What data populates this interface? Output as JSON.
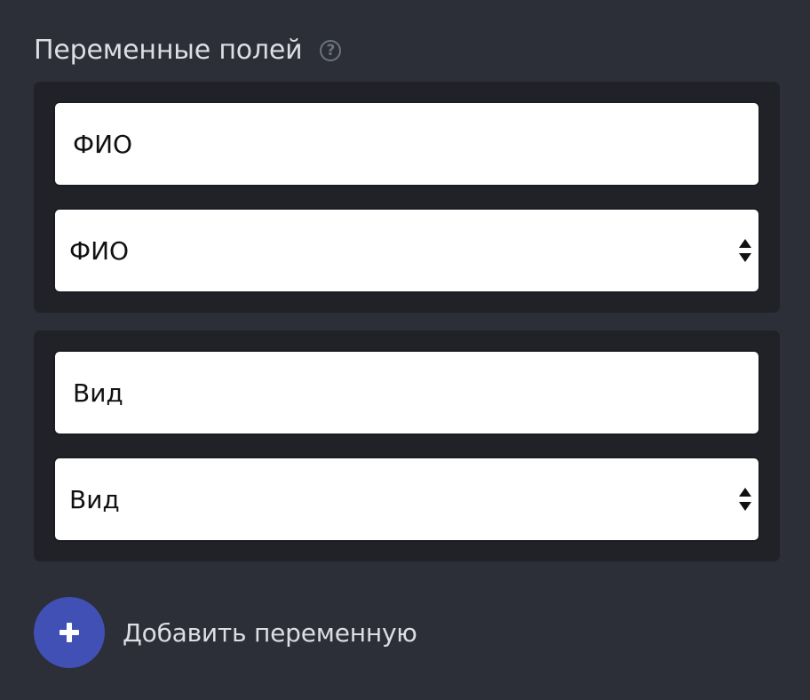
{
  "section": {
    "title": "Переменные полей",
    "help_icon": "question-circle-icon"
  },
  "variables": [
    {
      "name_value": "ФИО",
      "field_selected": "ФИО"
    },
    {
      "name_value": "Вид",
      "field_selected": "Вид"
    }
  ],
  "add_button": {
    "icon": "plus-icon",
    "label": "Добавить переменную"
  },
  "colors": {
    "background": "#2c2f38",
    "group_background": "#212227",
    "accent": "#4150b5",
    "text_light": "#dcdee4"
  }
}
